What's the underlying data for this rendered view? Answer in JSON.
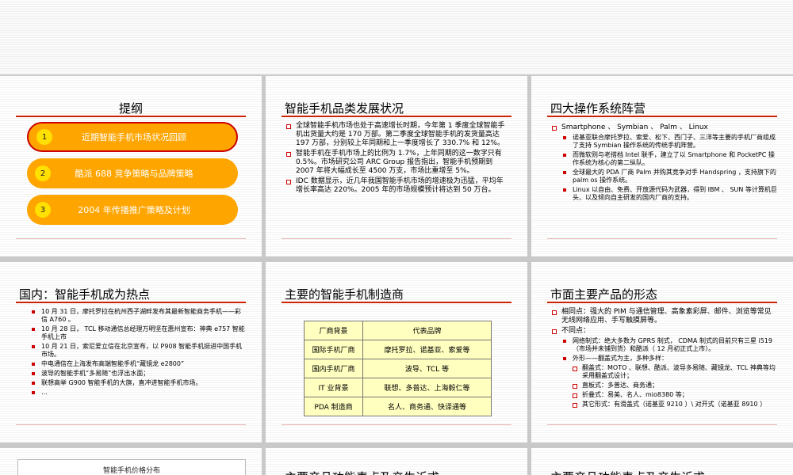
{
  "slides": {
    "outline": {
      "title": "提纲",
      "items": [
        {
          "num": "1",
          "label": "近期智能手机市场状况回顾"
        },
        {
          "num": "2",
          "label": "酷派 688 竞争策略与品牌策略"
        },
        {
          "num": "3",
          "label": "2004 年传播推广策略及计划"
        }
      ]
    },
    "category": {
      "title": "智能手机品类发展状况",
      "bullets": [
        "全球智能手机市场也处于高速增长时期，今年第 1 季度全球智能手机出货量大约是 170 万部。第二季度全球智能手机的发货量高达 197 万部，分别较上年同期和上一季度增长了 330.7% 和 12%。",
        "智能手机在手机市场上的比例为 1.7%，上年同期的这一数字只有 0.5%。市场研究公司 ARC Group 报告指出，智能手机预期到 2007 年将大幅成长至 4500 万支，市场比重增至 5%。",
        "IDC 数据显示，近几年我国智能手机市场的增速极为迅猛，平均年增长率高达 220%。2005 年的市场规模预计将达到 50 万台。"
      ]
    },
    "os": {
      "title": "四大操作系统阵营",
      "top": "Smartphone 、 Symbian 、 Palm 、 Linux",
      "bullets": [
        "诺基亚联合摩托罗拉、索爱、松下、西门子、三洋等主要的手机厂商组成了支持 Symbian 操作系统的传统手机阵营。",
        "而微软则与老搭档 Intel 联手，建立了以 Smartphone 和 PocketPC 操作系统为核心的第二纵队。",
        "全球最大的 PDA 厂商 Palm 并购其竞争对手 Handspring ，支持旗下的 palm os 操作系统。",
        "Linux 以自由、免费、开放源代码为武器，得到 IBM 、 SUN 等计算机巨头、以及倾向自主研发的国内厂商的支持。"
      ]
    },
    "domestic": {
      "title": "国内：智能手机成为热点",
      "bullets": [
        "10 月 31 日，摩托罗拉在杭州西子湖畔发布其最新智能商务手机——彩信 A760 。",
        "10 月 28 日， TCL 移动通信总经理万明坚在惠州宣布：神典 e757 智能手机上市",
        "10 月 21 日，索尼爱立信在北京宣布，以 P908 智能手机挺进中国手机市场。",
        "中电通信在上海发布高端智能手机“藏镜龙 e2800”",
        "波导的智能手机“多易随”也浮出水面；",
        "联想高举 G900 智能手机的大旗，直冲进智能手机市场。",
        "…"
      ]
    },
    "makers": {
      "title": "主要的智能手机制造商",
      "header": [
        "厂商背景",
        "代表品牌"
      ],
      "rows": [
        [
          "国际手机厂商",
          "摩托罗拉、诺基亚、索爱等"
        ],
        [
          "国内手机厂商",
          "波导、TCL 等"
        ],
        [
          "IT 业背景",
          "联想、多普达、上海毅仁等"
        ],
        [
          "PDA 制造商",
          "名人、商务通、快译通等"
        ]
      ]
    },
    "products": {
      "title": "市面主要产品的形态",
      "same": "相同点：强大的 PIM 与通信管理、高象素彩屏、邮件、浏览等常见无线网络应用、手写触摸屏等。",
      "diff": "不同点：",
      "network": "网络制式：绝大多数为 GPRS 制式， CDMA 制式的目前只有三星 i519 （市场并未铺到货）和酷派（ 12 月初正式上市）。",
      "form": "外形——翻盖式为主，多种多样：",
      "forms": [
        "翻盖式：MOTO 、联想、酷派、波导多易随、藏镜龙、TCL 神典等均采用翻盖式设计；",
        "直板式：多普达、商务通；",
        "折叠式：易美、名人、mio8380 等；",
        "其它形式：有滑盖式（诺基亚 9210 ）\\ 对开式（诺基亚 8910 ）"
      ]
    },
    "price": {
      "chart_title": "智能手机价格分布"
    },
    "feature_a": {
      "title": "主要产品功能表点及产生诉求"
    },
    "feature_b": {
      "title": "主要产品功能表点及产生诉求"
    }
  }
}
